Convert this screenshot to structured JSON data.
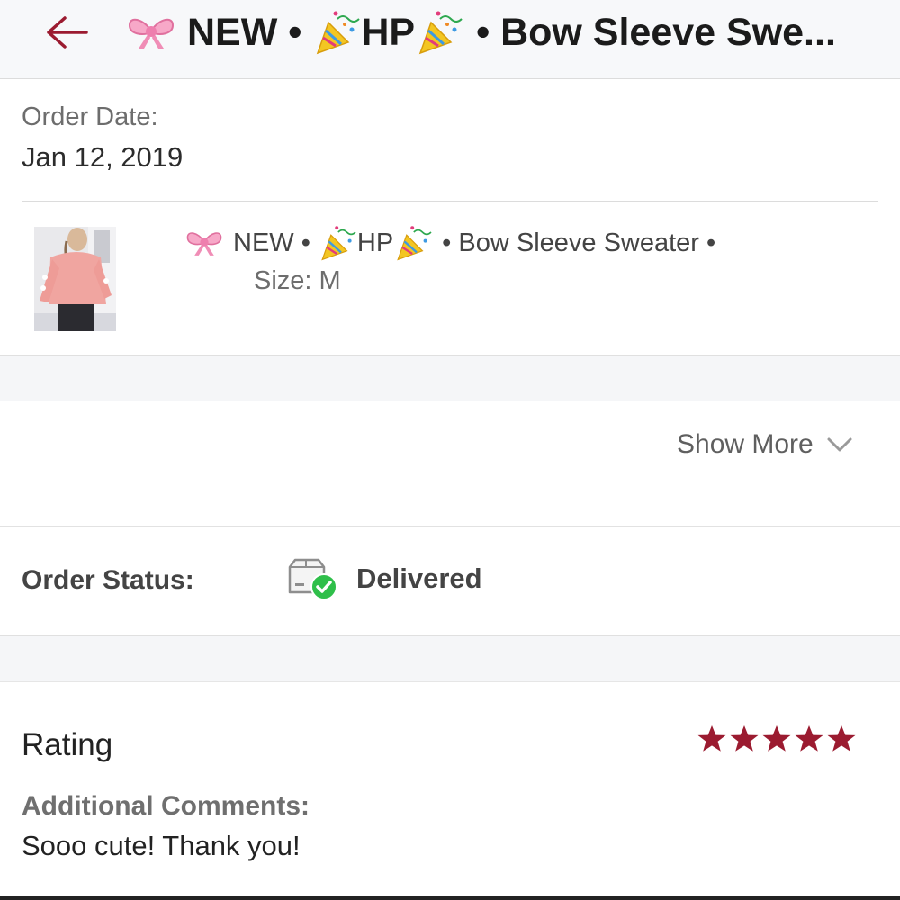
{
  "header": {
    "back_icon": "arrow-left-icon",
    "title": {
      "part1": "NEW •",
      "part2": "HP",
      "part3": "• Bow Sleeve Swe..."
    },
    "accent_color": "#9b1b30"
  },
  "order": {
    "date_label": "Order Date:",
    "date_value": "Jan 12, 2019"
  },
  "item": {
    "title_part1": "NEW •",
    "title_part2": "HP",
    "title_part3": "• Bow Sleeve Sweater •",
    "size": "Size: M"
  },
  "details": {
    "show_more_label": "Show More"
  },
  "status": {
    "label": "Order Status:",
    "value": "Delivered",
    "icon": "package-delivered-icon",
    "color": "#2fbf4a"
  },
  "rating": {
    "label": "Rating",
    "value": 5,
    "max": 5,
    "star_color": "#9b1b30",
    "comments_label": "Additional Comments:",
    "comments_value": "Sooo cute! Thank you!"
  }
}
